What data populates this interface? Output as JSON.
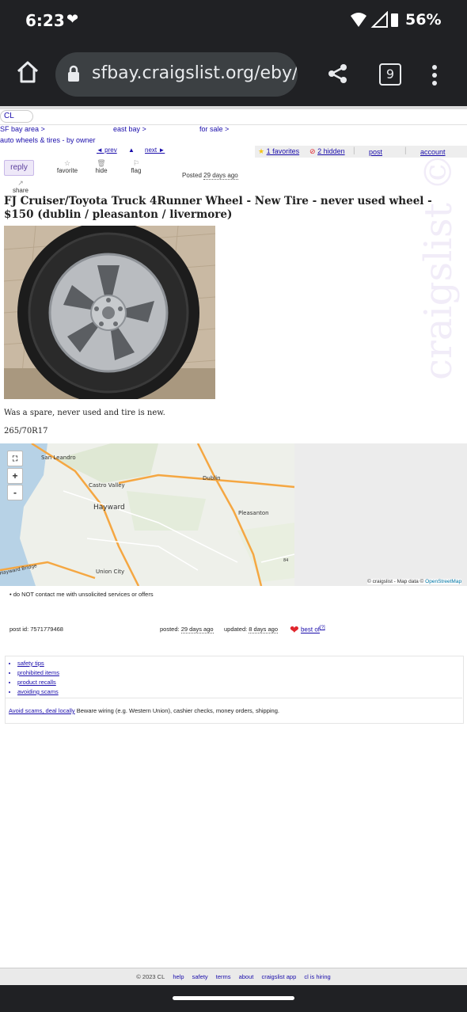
{
  "status_bar": {
    "time": "6:23",
    "battery": "56%",
    "icons": [
      "heart-pulse-icon",
      "wifi-icon",
      "signal-icon",
      "battery-icon"
    ]
  },
  "browser": {
    "url": "sfbay.craigslist.org/eby/",
    "tab_count": "9"
  },
  "page": {
    "cl_label": "CL",
    "breadcrumbs": [
      "SF bay area >",
      "east bay >",
      "for sale >"
    ],
    "subcategory": "auto wheels & tires - by owner",
    "nav": {
      "prev": "◄ prev",
      "up": "▲",
      "next": "next ►"
    },
    "userbar": {
      "favorites": "1 favorites",
      "hidden": "2 hidden",
      "post": "post",
      "account": "account"
    },
    "actions": {
      "reply": "reply",
      "favorite": "favorite",
      "hide": "hide",
      "flag": "flag",
      "share": "share"
    },
    "posted_label": "Posted",
    "posted_ago": "29 days ago",
    "title": "FJ Cruiser/Toyota Truck 4Runner Wheel - New Tire - never used wheel - $150 (dublin / pleasanton / livermore)",
    "watermark": "craigslist ©",
    "description": "Was a spare, never used and tire is new.",
    "tire_size": "265/70R17",
    "map": {
      "labels": [
        "San Leandro",
        "Castro Valley",
        "Hayward",
        "Dublin",
        "Pleasanton",
        "Union City",
        "Hayward Bridge",
        "84"
      ],
      "zoom_in": "+",
      "zoom_out": "-",
      "attribution_a": "© craigslist - Map data ©",
      "attribution_b": "OpenStreetMap"
    },
    "notice": "do NOT contact me with unsolicited services or offers",
    "post_id": "post id: 7571779468",
    "posted_footer_label": "posted:",
    "posted_footer_value": "29 days ago",
    "updated_label": "updated:",
    "updated_value": "8 days ago",
    "best_of": "best of",
    "best_of_sup": "[?]",
    "tips": [
      "safety tips",
      "prohibited items",
      "product recalls",
      "avoiding scams"
    ],
    "scam_link": "Avoid scams, deal locally",
    "scam_text": " Beware wiring (e.g. Western Union), cashier checks, money orders, shipping."
  },
  "footer": {
    "copyright": "© 2023 CL",
    "links": [
      "help",
      "safety",
      "terms",
      "about",
      "craigslist app",
      "cl is hiring"
    ]
  },
  "colors": {
    "link": "#1a0dab",
    "chrome_dark": "#202124",
    "reply_bg": "#eee8f8",
    "best_of_heart": "#e0262d"
  }
}
